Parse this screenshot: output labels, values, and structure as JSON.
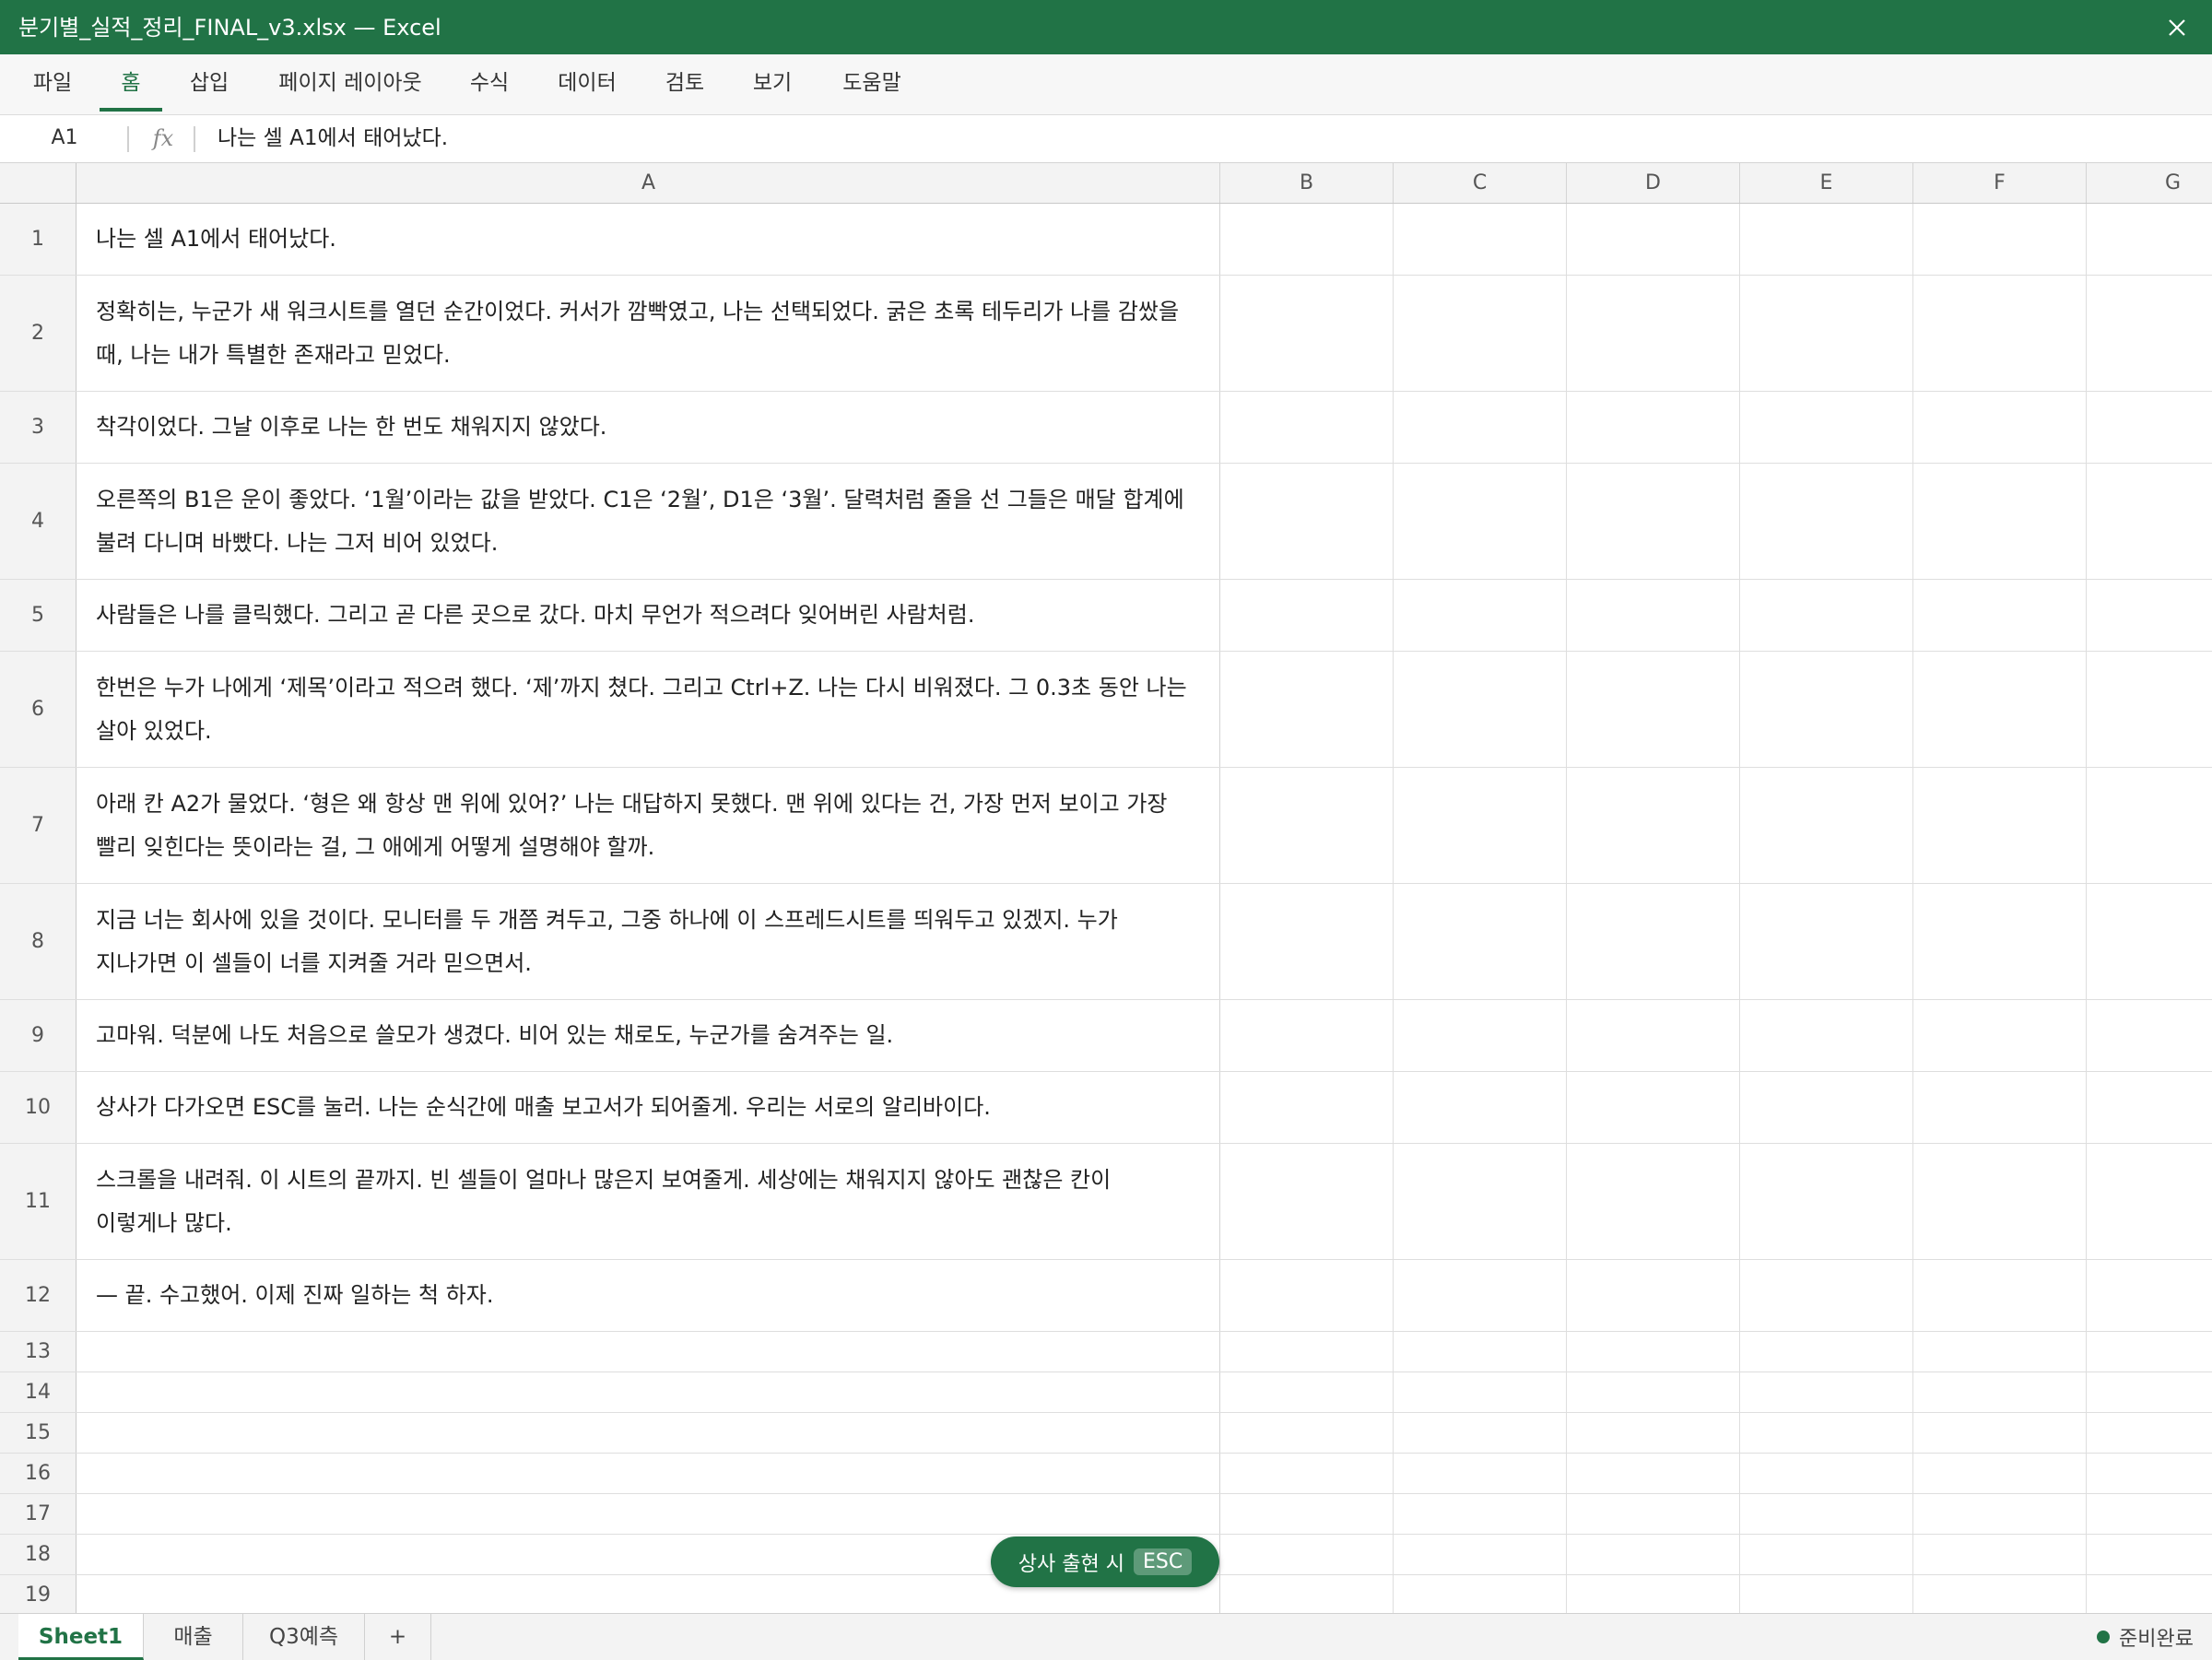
{
  "window": {
    "title": "분기별_실적_정리_FINAL_v3.xlsx — Excel"
  },
  "ribbon": {
    "tabs": [
      "파일",
      "홈",
      "삽입",
      "페이지 레이아웃",
      "수식",
      "데이터",
      "검토",
      "보기",
      "도움말"
    ],
    "active": "홈"
  },
  "formula_bar": {
    "name_box": "A1",
    "fx": "fx",
    "content": "나는 셀 A1에서 태어났다."
  },
  "columns": [
    "A",
    "B",
    "C",
    "D",
    "E",
    "F",
    "G"
  ],
  "rows": [
    {
      "num": "1",
      "lines": [
        "나는 셀 A1에서 태어났다."
      ]
    },
    {
      "num": "2",
      "lines": [
        "정확히는, 누군가 새 워크시트를 열던 순간이었다. 커서가 깜빡였고, 나는 선택되었다. 굵은 초록 테두리가 나를 감쌌을",
        "때, 나는 내가 특별한 존재라고 믿었다."
      ]
    },
    {
      "num": "3",
      "lines": [
        "착각이었다. 그날 이후로 나는 한 번도 채워지지 않았다."
      ]
    },
    {
      "num": "4",
      "lines": [
        "오른쪽의 B1은 운이 좋았다. ‘1월’이라는 값을 받았다. C1은 ‘2월’, D1은 ‘3월’. 달력처럼 줄을 선 그들은 매달 합계에",
        "불려 다니며 바빴다. 나는 그저 비어 있었다."
      ]
    },
    {
      "num": "5",
      "lines": [
        "사람들은 나를 클릭했다. 그리고 곧 다른 곳으로 갔다. 마치 무언가 적으려다 잊어버린 사람처럼."
      ]
    },
    {
      "num": "6",
      "lines": [
        "한번은 누가 나에게 ‘제목’이라고 적으려 했다. ‘제’까지 쳤다. 그리고 Ctrl+Z. 나는 다시 비워졌다. 그 0.3초 동안 나는",
        "살아 있었다."
      ]
    },
    {
      "num": "7",
      "lines": [
        "아래 칸 A2가 물었다. ‘형은 왜 항상 맨 위에 있어?’ 나는 대답하지 못했다. 맨 위에 있다는 건, 가장 먼저 보이고 가장",
        "빨리 잊힌다는 뜻이라는 걸, 그 애에게 어떻게 설명해야 할까."
      ]
    },
    {
      "num": "8",
      "lines": [
        "지금 너는 회사에 있을 것이다. 모니터를 두 개쯤 켜두고, 그중 하나에 이 스프레드시트를 띄워두고 있겠지. 누가",
        "지나가면 이 셀들이 너를 지켜줄 거라 믿으면서."
      ]
    },
    {
      "num": "9",
      "lines": [
        "고마워. 덕분에 나도 처음으로 쓸모가 생겼다. 비어 있는 채로도, 누군가를 숨겨주는 일."
      ]
    },
    {
      "num": "10",
      "lines": [
        "상사가 다가오면 ESC를 눌러. 나는 순식간에 매출 보고서가 되어줄게. 우리는 서로의 알리바이다."
      ]
    },
    {
      "num": "11",
      "lines": [
        "스크롤을 내려줘. 이 시트의 끝까지. 빈 셀들이 얼마나 많은지 보여줄게. 세상에는 채워지지 않아도 괜찮은 칸이",
        "이렇게나 많다."
      ]
    },
    {
      "num": "12",
      "lines": [
        "— 끝. 수고했어. 이제 진짜 일하는 척 하자."
      ]
    },
    {
      "num": "13",
      "lines": []
    },
    {
      "num": "14",
      "lines": []
    },
    {
      "num": "15",
      "lines": []
    },
    {
      "num": "16",
      "lines": []
    },
    {
      "num": "17",
      "lines": []
    },
    {
      "num": "18",
      "lines": []
    },
    {
      "num": "19",
      "lines": []
    }
  ],
  "esc_hint": {
    "label": "상사 출현 시",
    "key": "ESC"
  },
  "sheets": [
    "Sheet1",
    "매출",
    "Q3예측"
  ],
  "add_sheet": "+",
  "status": {
    "text": "준비완료"
  },
  "colors": {
    "brand": "#217346"
  },
  "icons": {
    "close": "close-icon",
    "status": "status-dot-icon"
  }
}
